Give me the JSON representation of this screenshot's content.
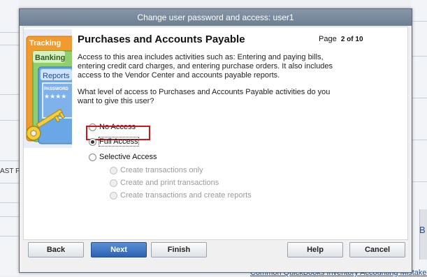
{
  "background": {
    "left_text": "AST F",
    "right_char": "B",
    "bottom_link": "Common QuickBooks Inventory Accounting Mistakes"
  },
  "dialog": {
    "title": "Change user password and access: user1",
    "heading": "Purchases and Accounts Payable",
    "page_label": "Page",
    "page_number": "2 of 10",
    "intro": "Access to this area includes activities such as: Entering and paying bills, entering credit card charges, and entering purchase orders. It also includes access to the Vendor Center and accounts payable reports.",
    "question": "What level of access to Purchases and Accounts Payable activities do you want to give this user?",
    "art": {
      "tab_tracking": "Tracking",
      "tab_banking": "Banking",
      "tab_reports": "Reports",
      "password_text": "PASSWORD",
      "password_mask": "★★★★"
    },
    "options": [
      {
        "label": "No Access",
        "selected": false,
        "disabled": false
      },
      {
        "label": "Full Access",
        "selected": true,
        "disabled": false
      },
      {
        "label": "Selective Access",
        "selected": false,
        "disabled": false
      }
    ],
    "sub_options": [
      {
        "label": "Create transactions only",
        "disabled": true
      },
      {
        "label": "Create and print transactions",
        "disabled": true
      },
      {
        "label": "Create transactions and create reports",
        "disabled": true
      }
    ],
    "buttons": {
      "back": "Back",
      "next": "Next",
      "finish": "Finish",
      "help": "Help",
      "cancel": "Cancel"
    }
  }
}
